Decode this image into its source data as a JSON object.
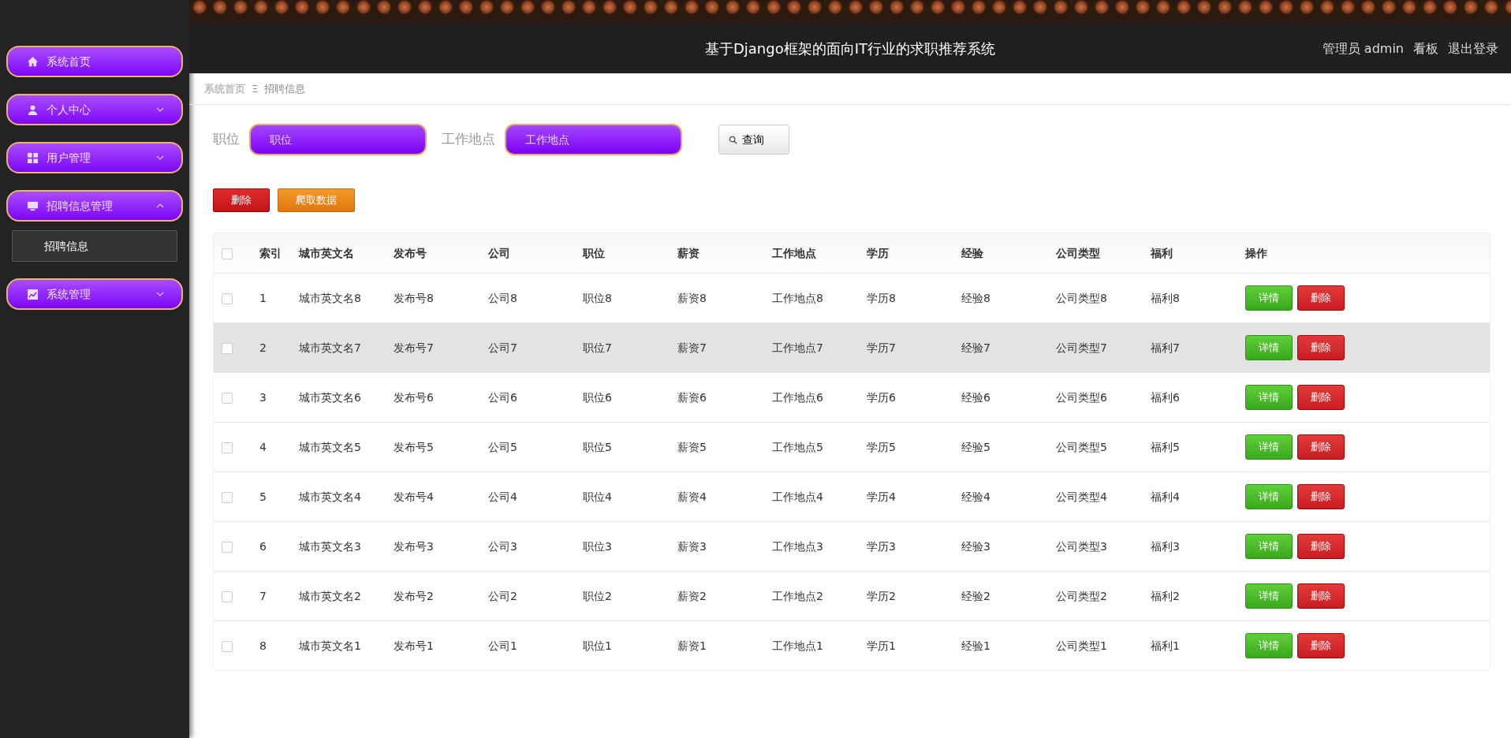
{
  "sidebar": {
    "items": [
      {
        "label": "系统首页"
      },
      {
        "label": "个人中心",
        "expanded": false
      },
      {
        "label": "用户管理",
        "expanded": false
      },
      {
        "label": "招聘信息管理",
        "expanded": true,
        "children": [
          {
            "label": "招聘信息"
          }
        ]
      },
      {
        "label": "系统管理",
        "expanded": false
      }
    ]
  },
  "header": {
    "title": "基于Django框架的面向IT行业的求职推荐系统",
    "links": [
      "管理员 admin",
      "看板",
      "退出登录"
    ]
  },
  "breadcrumb": [
    "系统首页",
    "招聘信息"
  ],
  "breadcrumb_separator": "Ξ",
  "search": {
    "fields": [
      {
        "label": "职位",
        "placeholder": "职位"
      },
      {
        "label": "工作地点",
        "placeholder": "工作地点"
      }
    ],
    "button": "查询"
  },
  "actions": [
    {
      "label": "删除",
      "kind": "danger"
    },
    {
      "label": "爬取数据",
      "kind": "warning"
    }
  ],
  "table": {
    "all_checked": false,
    "columns": [
      "索引",
      "城市英文名",
      "发布号",
      "公司",
      "职位",
      "薪资",
      "工作地点",
      "学历",
      "经验",
      "公司类型",
      "福利",
      "操作"
    ],
    "rows": [
      {
        "checked": false,
        "hovered": false,
        "cells": [
          "1",
          "城市英文名8",
          "发布号8",
          "公司8",
          "职位8",
          "薪资8",
          "工作地点8",
          "学历8",
          "经验8",
          "公司类型8",
          "福利8"
        ],
        "buttons": [
          "详情",
          "删除"
        ]
      },
      {
        "checked": false,
        "hovered": true,
        "cells": [
          "2",
          "城市英文名7",
          "发布号7",
          "公司7",
          "职位7",
          "薪资7",
          "工作地点7",
          "学历7",
          "经验7",
          "公司类型7",
          "福利7"
        ],
        "buttons": [
          "详情",
          "删除"
        ]
      },
      {
        "checked": false,
        "hovered": false,
        "cells": [
          "3",
          "城市英文名6",
          "发布号6",
          "公司6",
          "职位6",
          "薪资6",
          "工作地点6",
          "学历6",
          "经验6",
          "公司类型6",
          "福利6"
        ],
        "buttons": [
          "详情",
          "删除"
        ]
      },
      {
        "checked": false,
        "hovered": false,
        "cells": [
          "4",
          "城市英文名5",
          "发布号5",
          "公司5",
          "职位5",
          "薪资5",
          "工作地点5",
          "学历5",
          "经验5",
          "公司类型5",
          "福利5"
        ],
        "buttons": [
          "详情",
          "删除"
        ]
      },
      {
        "checked": false,
        "hovered": false,
        "cells": [
          "5",
          "城市英文名4",
          "发布号4",
          "公司4",
          "职位4",
          "薪资4",
          "工作地点4",
          "学历4",
          "经验4",
          "公司类型4",
          "福利4"
        ],
        "buttons": [
          "详情",
          "删除"
        ]
      },
      {
        "checked": false,
        "hovered": false,
        "cells": [
          "6",
          "城市英文名3",
          "发布号3",
          "公司3",
          "职位3",
          "薪资3",
          "工作地点3",
          "学历3",
          "经验3",
          "公司类型3",
          "福利3"
        ],
        "buttons": [
          "详情",
          "删除"
        ]
      },
      {
        "checked": false,
        "hovered": false,
        "cells": [
          "7",
          "城市英文名2",
          "发布号2",
          "公司2",
          "职位2",
          "薪资2",
          "工作地点2",
          "学历2",
          "经验2",
          "公司类型2",
          "福利2"
        ],
        "buttons": [
          "详情",
          "删除"
        ]
      },
      {
        "checked": false,
        "hovered": false,
        "cells": [
          "8",
          "城市英文名1",
          "发布号1",
          "公司1",
          "职位1",
          "薪资1",
          "工作地点1",
          "学历1",
          "经验1",
          "公司类型1",
          "福利1"
        ],
        "buttons": [
          "详情",
          "删除"
        ]
      }
    ]
  }
}
